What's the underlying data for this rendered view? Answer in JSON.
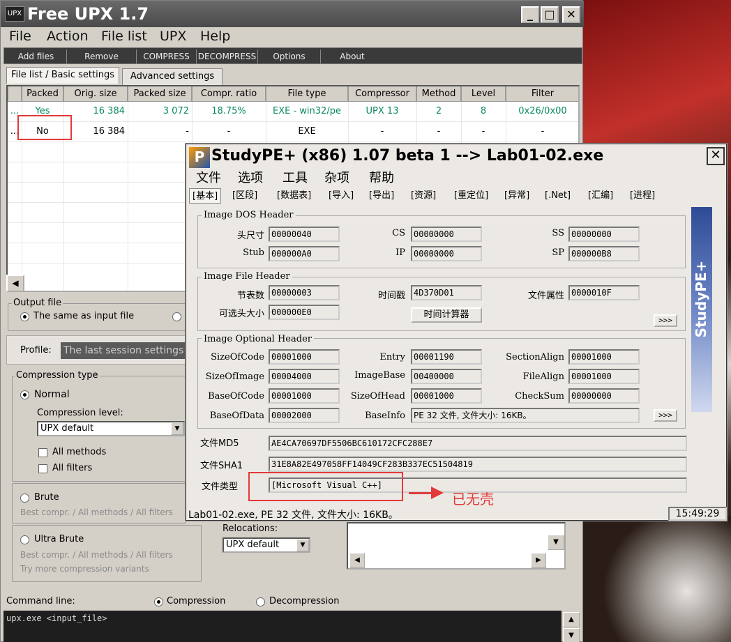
{
  "upx": {
    "title": "Free UPX 1.7",
    "logo": "UPX",
    "window_controls": {
      "minimize": "_",
      "maximize": "□",
      "close": "✕"
    },
    "menu": [
      "File",
      "Action",
      "File list",
      "UPX",
      "Help"
    ],
    "toolbar": [
      "Add files",
      "Remove",
      "COMPRESS",
      "DECOMPRESS",
      "Options",
      "About"
    ],
    "tabs": [
      "File list / Basic settings",
      "Advanced settings"
    ],
    "columns": [
      "Packed",
      "Orig. size",
      "Packed size",
      "Compr. ratio",
      "File type",
      "Compressor",
      "Method",
      "Level",
      "Filter"
    ],
    "rows": [
      {
        "prefix": "...",
        "packed": "Yes",
        "orig": "16 384",
        "packed_size": "3 072",
        "ratio": "18.75%",
        "type": "EXE - win32/pe",
        "compressor": "UPX 13",
        "method": "2",
        "level": "8",
        "filter": "0x26/0x00"
      },
      {
        "prefix": "...",
        "packed": "No",
        "orig": "16 384",
        "packed_size": "-",
        "ratio": "-",
        "type": "EXE",
        "compressor": "-",
        "method": "-",
        "level": "-",
        "filter": "-"
      }
    ],
    "output_file_label": "Output file",
    "output_same": "The same as input file",
    "profile_label": "Profile:",
    "profile_value": "The last session settings",
    "compression_type_label": "Compression type",
    "normal": "Normal",
    "compression_level_label": "Compression level:",
    "compression_level_value": "UPX default",
    "all_methods": "All methods",
    "all_filters": "All filters",
    "brute": "Brute",
    "brute_desc": "Best compr. / All methods / All filters",
    "ultra_brute": "Ultra Brute",
    "ultra_desc1": "Best compr. / All methods / All filters",
    "ultra_desc2": "Try more compression variants",
    "relocations_label": "Relocations:",
    "relocations_value": "UPX default",
    "command_line_label": "Command line:",
    "compression_radio": "Compression",
    "decompression_radio": "Decompression",
    "command": "upx.exe <input_file>"
  },
  "studype": {
    "logo": "P",
    "title": "StudyPE+ (x86) 1.07 beta 1  --> Lab01-02.exe",
    "close": "✕",
    "menu": [
      "文件",
      "选项",
      "工具",
      "杂项",
      "帮助"
    ],
    "tabs": [
      "[基本]",
      "[区段]",
      "[数据表]",
      "[导入]",
      "[导出]",
      "[资源]",
      "[重定位]",
      "[异常]",
      "[.Net]",
      "[汇编]",
      "[进程]"
    ],
    "sidebar_text": "StudyPE+",
    "dos": {
      "title": "Image DOS Header",
      "l1": "头尺寸",
      "v1": "00000040",
      "l2": "CS",
      "v2": "00000000",
      "l3": "SS",
      "v3": "00000000",
      "l4": "Stub",
      "v4": "000000A0",
      "l5": "IP",
      "v5": "00000000",
      "l6": "SP",
      "v6": "000000B8"
    },
    "file": {
      "title": "Image File Header",
      "l1": "节表数",
      "v1": "00000003",
      "l2": "时间戳",
      "v2": "4D370D01",
      "l3": "文件属性",
      "v3": "0000010F",
      "l4": "可选头大小",
      "v4": "000000E0",
      "calc_button": "时间计算器",
      "more": ">>>"
    },
    "optional": {
      "title": "Image Optional Header",
      "rows": [
        [
          "SizeOfCode",
          "00001000",
          "Entry",
          "00001190",
          "SectionAlign",
          "00001000"
        ],
        [
          "SizeOfImage",
          "00004000",
          "ImageBase",
          "00400000",
          "FileAlign",
          "00001000"
        ],
        [
          "BaseOfCode",
          "00001000",
          "SizeOfHead",
          "00001000",
          "CheckSum",
          "00000000"
        ]
      ],
      "l_bod": "BaseOfData",
      "v_bod": "00002000",
      "l_bi": "BaseInfo",
      "v_bi": "PE 32 文件, 文件大小: 16KB。",
      "more": ">>>"
    },
    "md5_label": "文件MD5",
    "md5": "AE4CA70697DF5506BC610172CFC288E7",
    "sha1_label": "文件SHA1",
    "sha1": "31E8A82E497058FF14049CF283B337EC51504819",
    "type_label": "文件类型",
    "type": "[Microsoft Visual C++]",
    "status": "Lab01-02.exe, PE 32 文件, 文件大小: 16KB。",
    "time": "15:49:29"
  },
  "annotation": "已无壳",
  "colors": {
    "annotation": "#e23a3a",
    "packed_text": "#0a8a5a"
  }
}
